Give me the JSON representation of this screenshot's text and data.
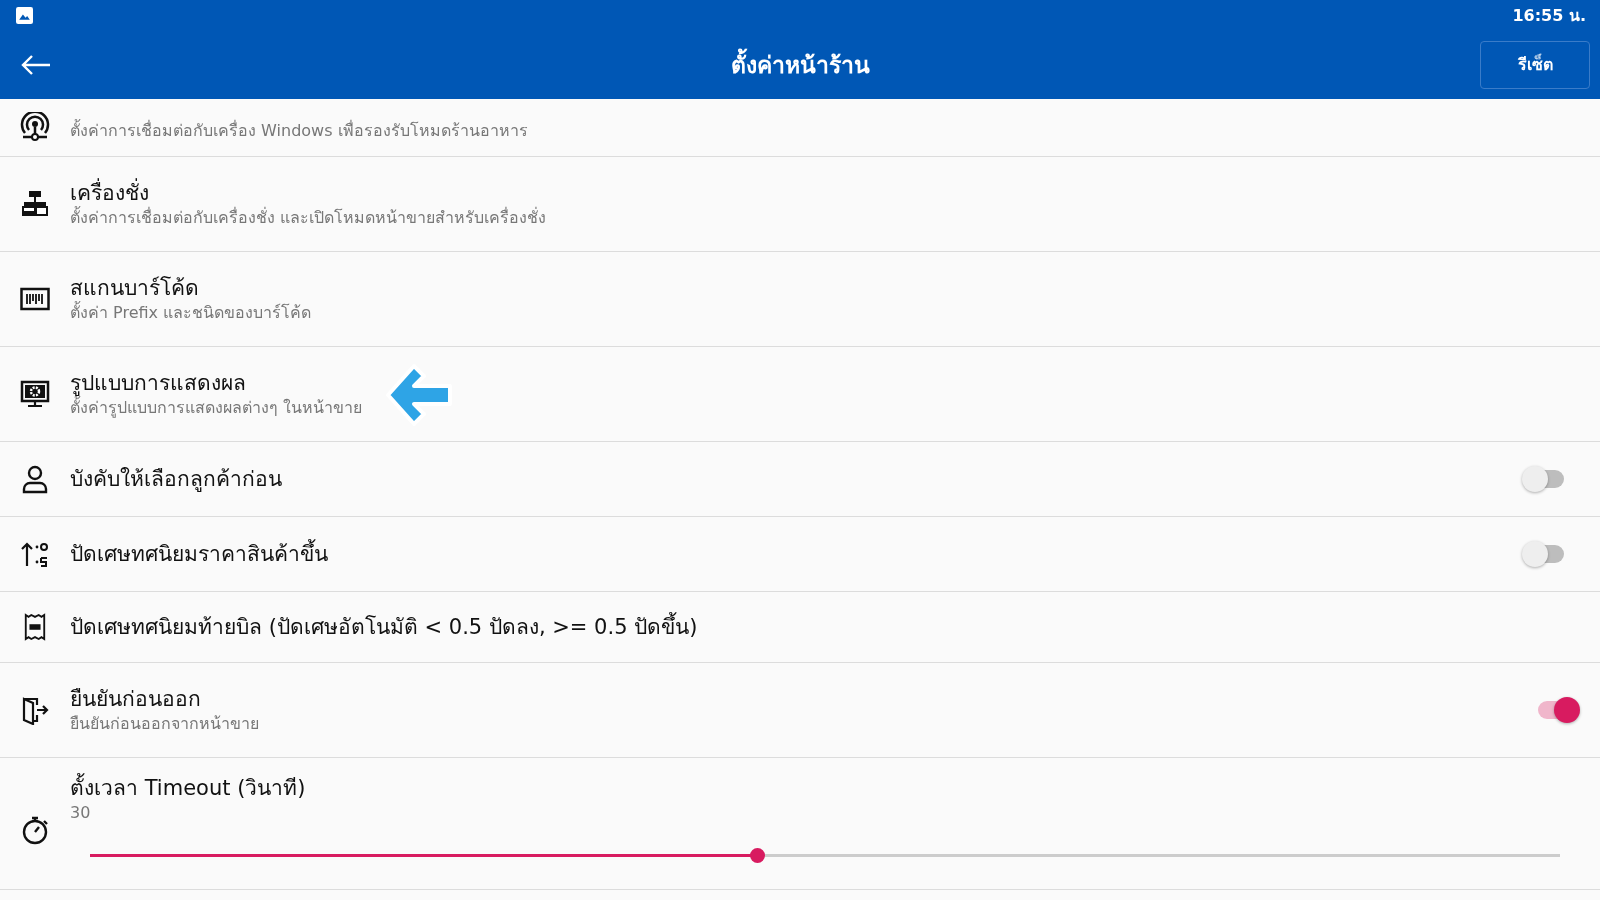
{
  "status_bar": {
    "time": "16:55 น."
  },
  "app_bar": {
    "title": "ตั้งค่าหน้าร้าน",
    "action": "รีเซ็ต"
  },
  "settings": [
    {
      "kind": "link",
      "description": "ตั้งค่าการเชื่อมต่อกับเครื่อง Windows เพื่อรองรับโหมดร้านอาหาร"
    },
    {
      "kind": "link",
      "title": "เครื่องชั่ง",
      "description": "ตั้งค่าการเชื่อมต่อกับเครื่องชั่ง และเปิดโหมดหน้าขายสำหรับเครื่องชั่ง"
    },
    {
      "kind": "link",
      "title": "สแกนบาร์โค้ด",
      "description": "ตั้งค่า Prefix และชนิดของบาร์โค้ด"
    },
    {
      "kind": "link",
      "title": "รูปแบบการแสดงผล",
      "description": "ตั้งค่ารูปแบบการแสดงผลต่างๆ ในหน้าขาย",
      "highlighted": true
    },
    {
      "kind": "toggle",
      "title": "บังคับให้เลือกลูกค้าก่อน",
      "on": false
    },
    {
      "kind": "toggle",
      "title": "ปัดเศษทศนิยมราคาสินค้าขึ้น",
      "on": false
    },
    {
      "kind": "link",
      "title": "ปัดเศษทศนิยมท้ายบิล (ปัดเศษอัตโนมัติ < 0.5 ปัดลง, >= 0.5 ปัดขึ้น)"
    },
    {
      "kind": "toggle",
      "title": "ยืนยันก่อนออก",
      "description": "ยืนยันก่อนออกจากหน้าขาย",
      "on": true
    },
    {
      "kind": "slider",
      "title": "ตั้งเวลา Timeout (วินาที)",
      "description": "30",
      "level": 0.454
    }
  ]
}
